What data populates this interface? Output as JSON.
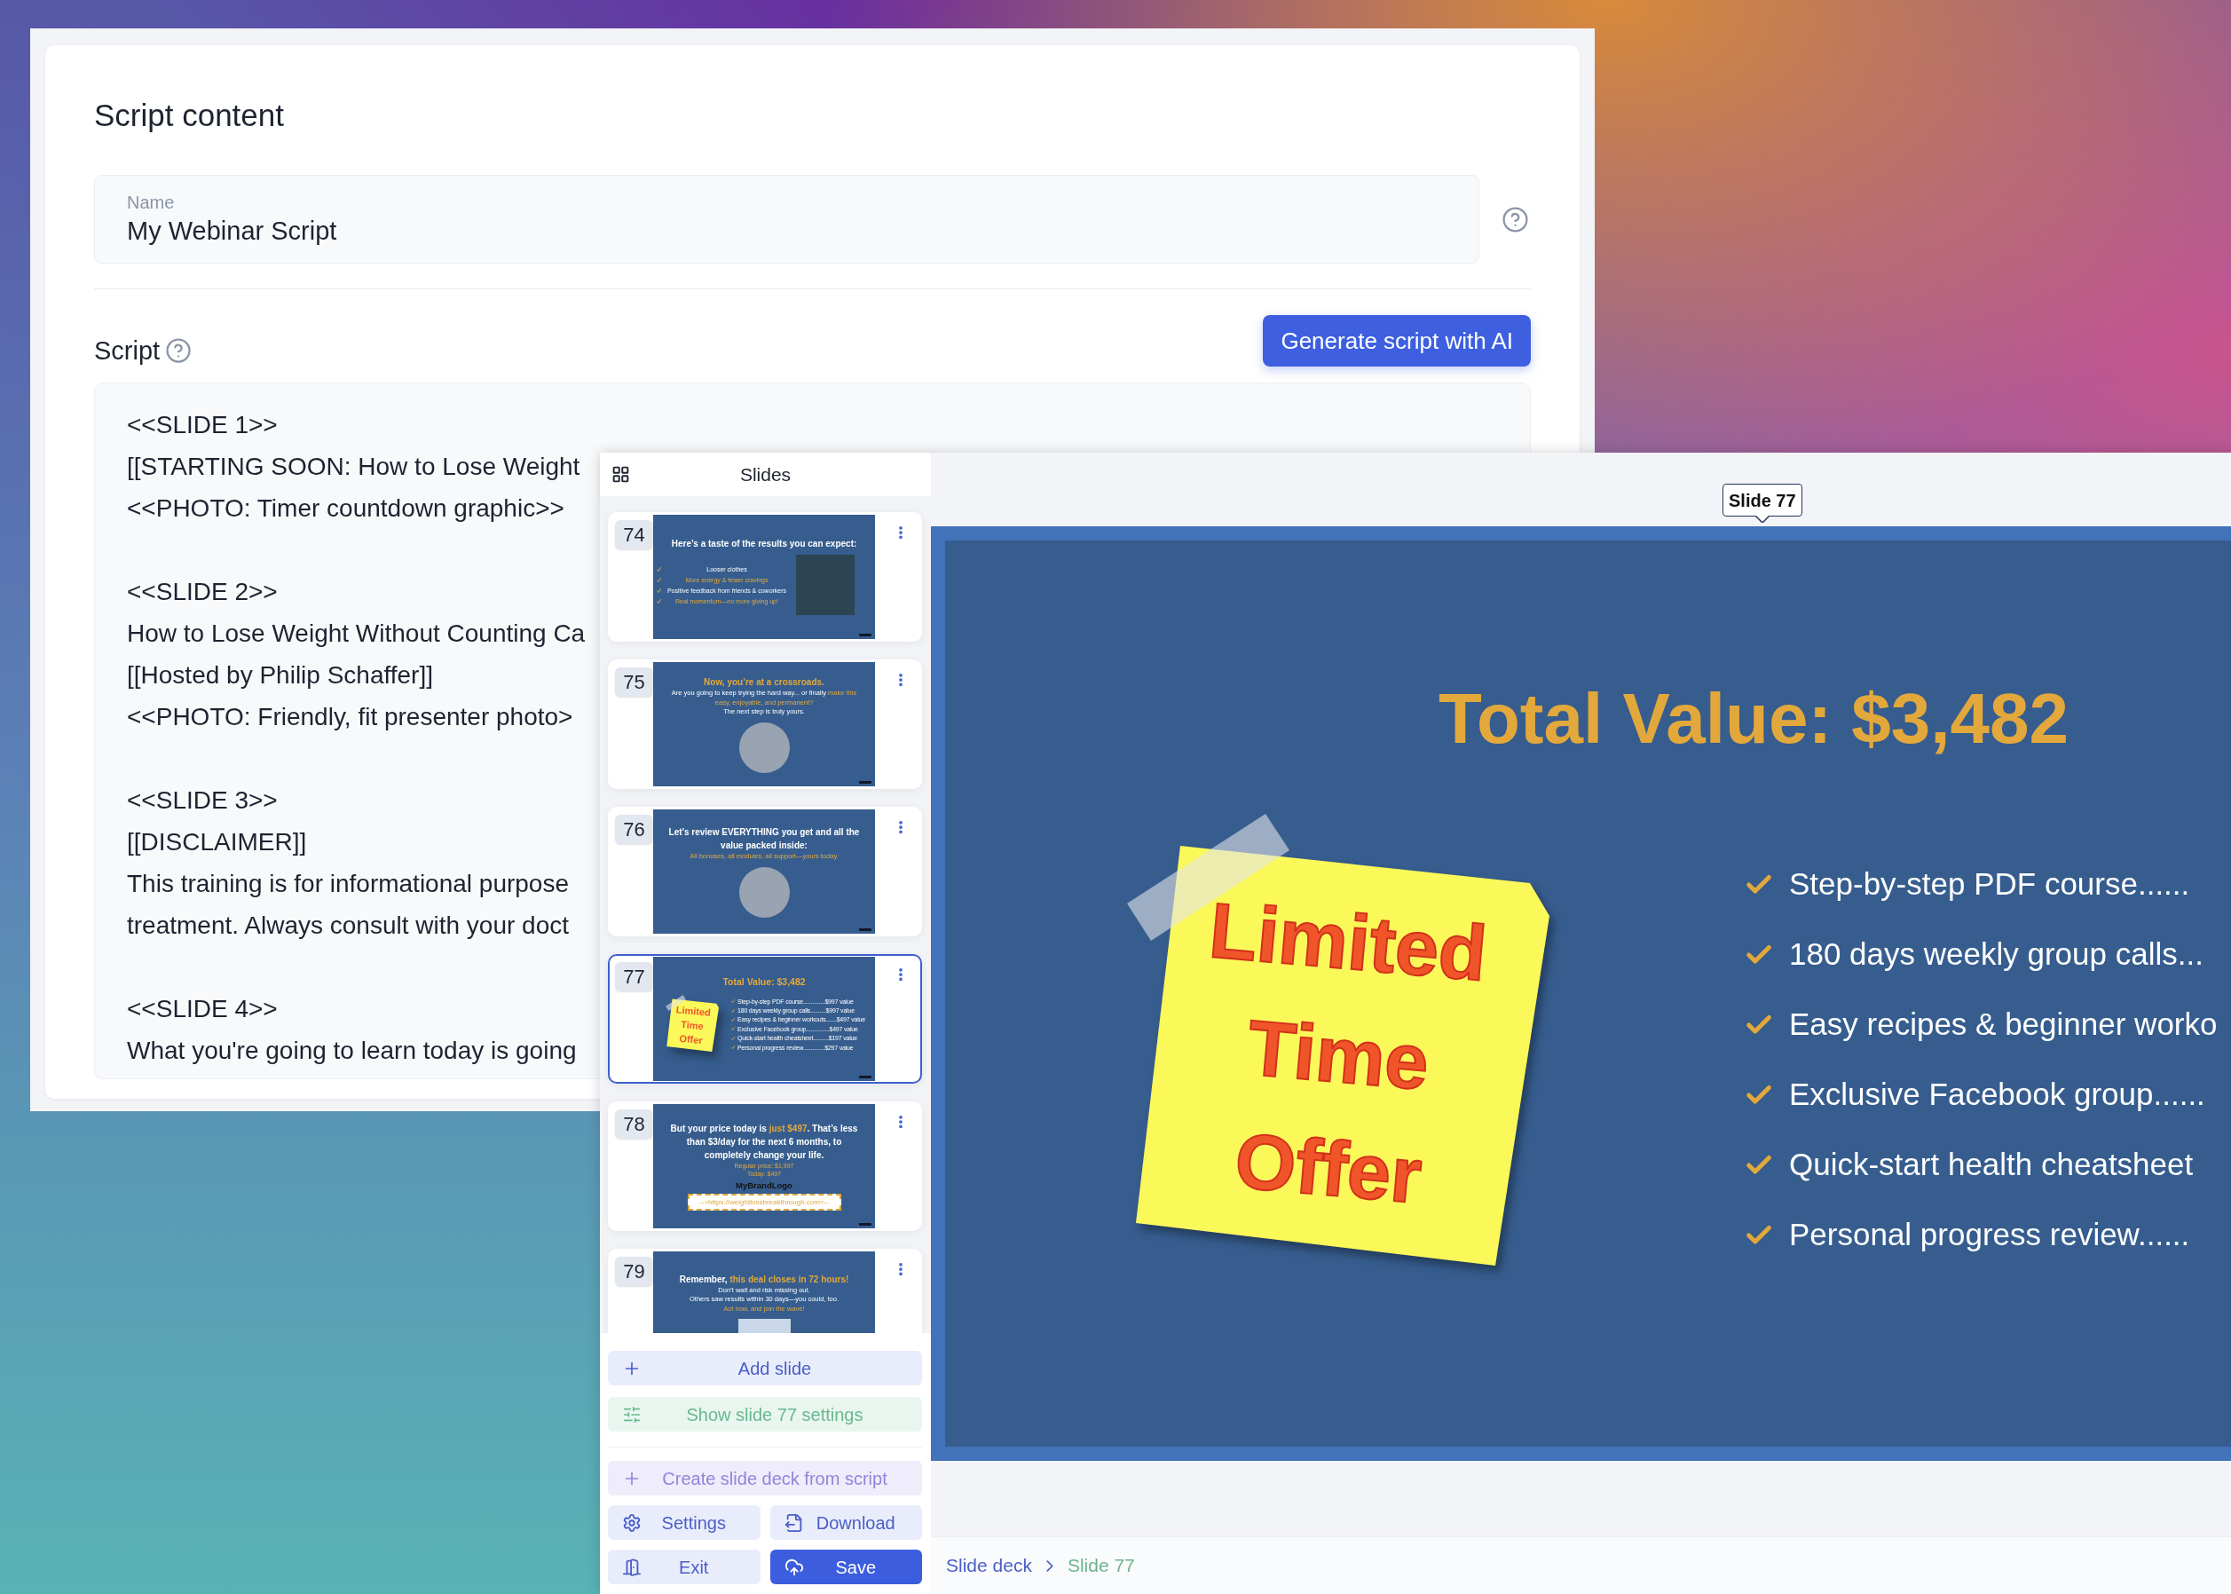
{
  "script_editor": {
    "title": "Script content",
    "name_field": {
      "label": "Name",
      "value": "My Webinar Script"
    },
    "script_label": "Script",
    "generate_button": "Generate script with AI",
    "script_blocks": [
      {
        "lines": [
          "<<SLIDE 1>>",
          "[[STARTING SOON: How to Lose Weight",
          "<<PHOTO: Timer countdown graphic>>"
        ]
      },
      {
        "lines": [
          "<<SLIDE 2>>",
          "How to Lose Weight Without Counting Ca",
          "[[Hosted by Philip Schaffer]]",
          "<<PHOTO: Friendly, fit presenter photo>"
        ]
      },
      {
        "lines": [
          "<<SLIDE 3>>",
          "[[DISCLAIMER]]",
          "This training is for informational purpose",
          "treatment. Always consult with your doct"
        ]
      },
      {
        "lines": [
          "<<SLIDE 4>>",
          "What you're going to learn today is going"
        ]
      }
    ]
  },
  "slides_panel": {
    "title": "Slides",
    "slides": [
      {
        "number": "74",
        "selected": false,
        "kind": "checklist",
        "title": "Here’s a taste of the results you can expect:",
        "items": [
          {
            "text": "Looser clothes",
            "highlight": false
          },
          {
            "text": "More energy & fewer cravings",
            "highlight": true
          },
          {
            "text": "Positive feedback from friends & coworkers",
            "highlight": false
          },
          {
            "text": "Real momentum—no more giving up!",
            "highlight": true
          }
        ]
      },
      {
        "number": "75",
        "selected": false,
        "kind": "statement",
        "blocks": [
          {
            "kind": "heading",
            "segments": [
              {
                "text": "Now, you’re at a crossroads.",
                "highlight": true
              }
            ]
          },
          {
            "kind": "line",
            "segments": [
              {
                "text": "Are you going to keep trying the hard way... or finally ",
                "highlight": false
              },
              {
                "text": "make this easy, enjoyable, and permanent?",
                "highlight": true
              }
            ]
          },
          {
            "kind": "line",
            "segments": [
              {
                "text": "The next step is truly yours.",
                "highlight": false
              }
            ]
          },
          {
            "kind": "round_photo"
          }
        ]
      },
      {
        "number": "76",
        "selected": false,
        "kind": "statement",
        "blocks": [
          {
            "kind": "heading",
            "segments": [
              {
                "text": "Let’s review EVERYTHING you get and all the value packed inside:",
                "highlight": false
              }
            ]
          },
          {
            "kind": "line",
            "segments": [
              {
                "text": "All bonuses, all modules, all support—yours today.",
                "highlight": true
              }
            ]
          },
          {
            "kind": "round_photo"
          }
        ]
      },
      {
        "number": "77",
        "selected": true,
        "kind": "offer",
        "title": "Total Value: $3,482",
        "note": "Limited Time Offer",
        "items": [
          "Step-by-step PDF course..............$997 value",
          "180 days weekly group calls..........$997 value",
          "Easy recipes & beginner workouts.......$497 value",
          "Exclusive Facebook group...............$497 value",
          "Quick-start health cheatsheet..........$197 value",
          "Personal progress review..............$297 value"
        ]
      },
      {
        "number": "78",
        "selected": false,
        "kind": "statement",
        "blocks": [
          {
            "kind": "heading",
            "segments": [
              {
                "text": "But your price today is ",
                "highlight": false
              },
              {
                "text": "just $497",
                "highlight": true
              },
              {
                "text": ". That’s less than $3/day for the next 6 months, to completely change your life.",
                "highlight": false
              }
            ]
          },
          {
            "kind": "small",
            "segments": [
              {
                "text": "Regular price: $1,997",
                "highlight": true
              }
            ]
          },
          {
            "kind": "small",
            "segments": [
              {
                "text": "Today: $497",
                "highlight": true
              }
            ]
          },
          {
            "kind": "logo",
            "segments": [
              {
                "text": "MyBrandLogo",
                "highlight": false
              }
            ]
          },
          {
            "kind": "link",
            "segments": [
              {
                "text": "-->https://weightlossbreakthrough.com<--",
                "highlight": true
              }
            ]
          }
        ]
      },
      {
        "number": "79",
        "selected": false,
        "kind": "statement",
        "blocks": [
          {
            "kind": "heading",
            "segments": [
              {
                "text": "Remember, ",
                "highlight": false
              },
              {
                "text": "this deal closes in 72 hours!",
                "highlight": true
              }
            ]
          },
          {
            "kind": "line",
            "segments": [
              {
                "text": "Don’t wait and risk missing out.",
                "highlight": false
              }
            ]
          },
          {
            "kind": "line",
            "segments": [
              {
                "text": "Others saw results within 30 days—you could, too.",
                "highlight": false
              }
            ]
          },
          {
            "kind": "line",
            "segments": [
              {
                "text": "Act now, and join the wave!",
                "highlight": true
              }
            ]
          },
          {
            "kind": "wide_photo"
          }
        ]
      }
    ],
    "add_button": "Add slide",
    "settings_toggle": "Show slide 77 settings",
    "create_button": "Create slide deck from script",
    "actions": [
      {
        "label": "Settings",
        "kind": "settings",
        "primary": false
      },
      {
        "label": "Download",
        "kind": "download",
        "primary": false
      },
      {
        "label": "Exit",
        "kind": "exit",
        "primary": false
      },
      {
        "label": "Save",
        "kind": "save",
        "primary": true
      }
    ]
  },
  "canvas": {
    "tooltip": "Slide 77",
    "slide": {
      "title": "Total Value: $3,482",
      "note": "Limited Time Offer",
      "items": [
        "Step-by-step PDF course......",
        "180 days weekly group calls...",
        "Easy recipes & beginner worko",
        "Exclusive Facebook group......",
        "Quick-start health cheatsheet",
        "Personal progress review......"
      ]
    }
  },
  "breadcrumb": [
    {
      "label": "Slide deck",
      "current": false
    },
    {
      "label": "Slide 77",
      "current": true
    }
  ]
}
